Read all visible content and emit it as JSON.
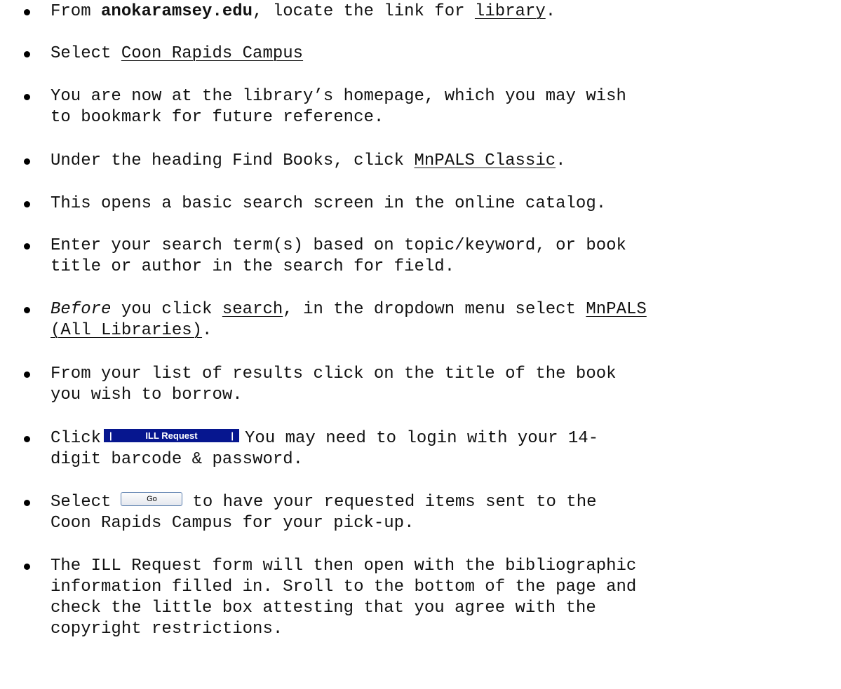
{
  "steps": [
    {
      "lines": [
        {
          "pre": "From ",
          "bold": "anokaramsey.edu",
          "mid": ", locate the link for ",
          "link": "library",
          "post": "."
        }
      ]
    },
    {
      "lines": [
        {
          "pre": "Select ",
          "link": "Coon Rapids Campus"
        }
      ]
    },
    {
      "lines": [
        {
          "text": "You are now at the library’s homepage, which you may wish"
        },
        {
          "text": "to bookmark for future reference."
        }
      ]
    },
    {
      "lines": [
        {
          "pre": "Under the heading Find Books, click ",
          "link": "MnPALS Classic",
          "post": "."
        }
      ]
    },
    {
      "lines": [
        {
          "text": "This opens a basic search screen in the online catalog."
        }
      ]
    },
    {
      "lines": [
        {
          "text": "Enter your search term(s) based on topic/keyword, or book"
        },
        {
          "text": "title or author in the search for field."
        }
      ]
    },
    {
      "lines": [
        {
          "italic": "Before",
          "mid": " you click ",
          "link": "search",
          "mid2": ", in the dropdown menu select ",
          "link2": "MnPALS"
        },
        {
          "link": "(All Libraries)",
          "post": "."
        }
      ]
    },
    {
      "lines": [
        {
          "text": "From your list of results click on the title of the book"
        },
        {
          "text": "you wish to borrow."
        }
      ]
    },
    {
      "lines": [
        {
          "pre": "Click",
          "button": "ill",
          "post": "You may need to login with your 14-"
        },
        {
          "text": "digit barcode & password."
        }
      ]
    },
    {
      "lines": [
        {
          "pre": "Select",
          "button": "go",
          "post": "to have your requested items sent to the"
        },
        {
          "text": "Coon Rapids Campus for your pick-up."
        }
      ]
    },
    {
      "lines": [
        {
          "text": "The ILL Request form will then open with the bibliographic"
        },
        {
          "text": "information filled in. Sroll to the bottom of the page and"
        },
        {
          "text": "check the little box attesting that you agree with the"
        },
        {
          "text": "copyright restrictions."
        }
      ]
    }
  ],
  "buttons": {
    "ill": {
      "label": "ILL Request",
      "pipe": "|",
      "color": "#06168f"
    },
    "go": {
      "label": "Go"
    }
  }
}
